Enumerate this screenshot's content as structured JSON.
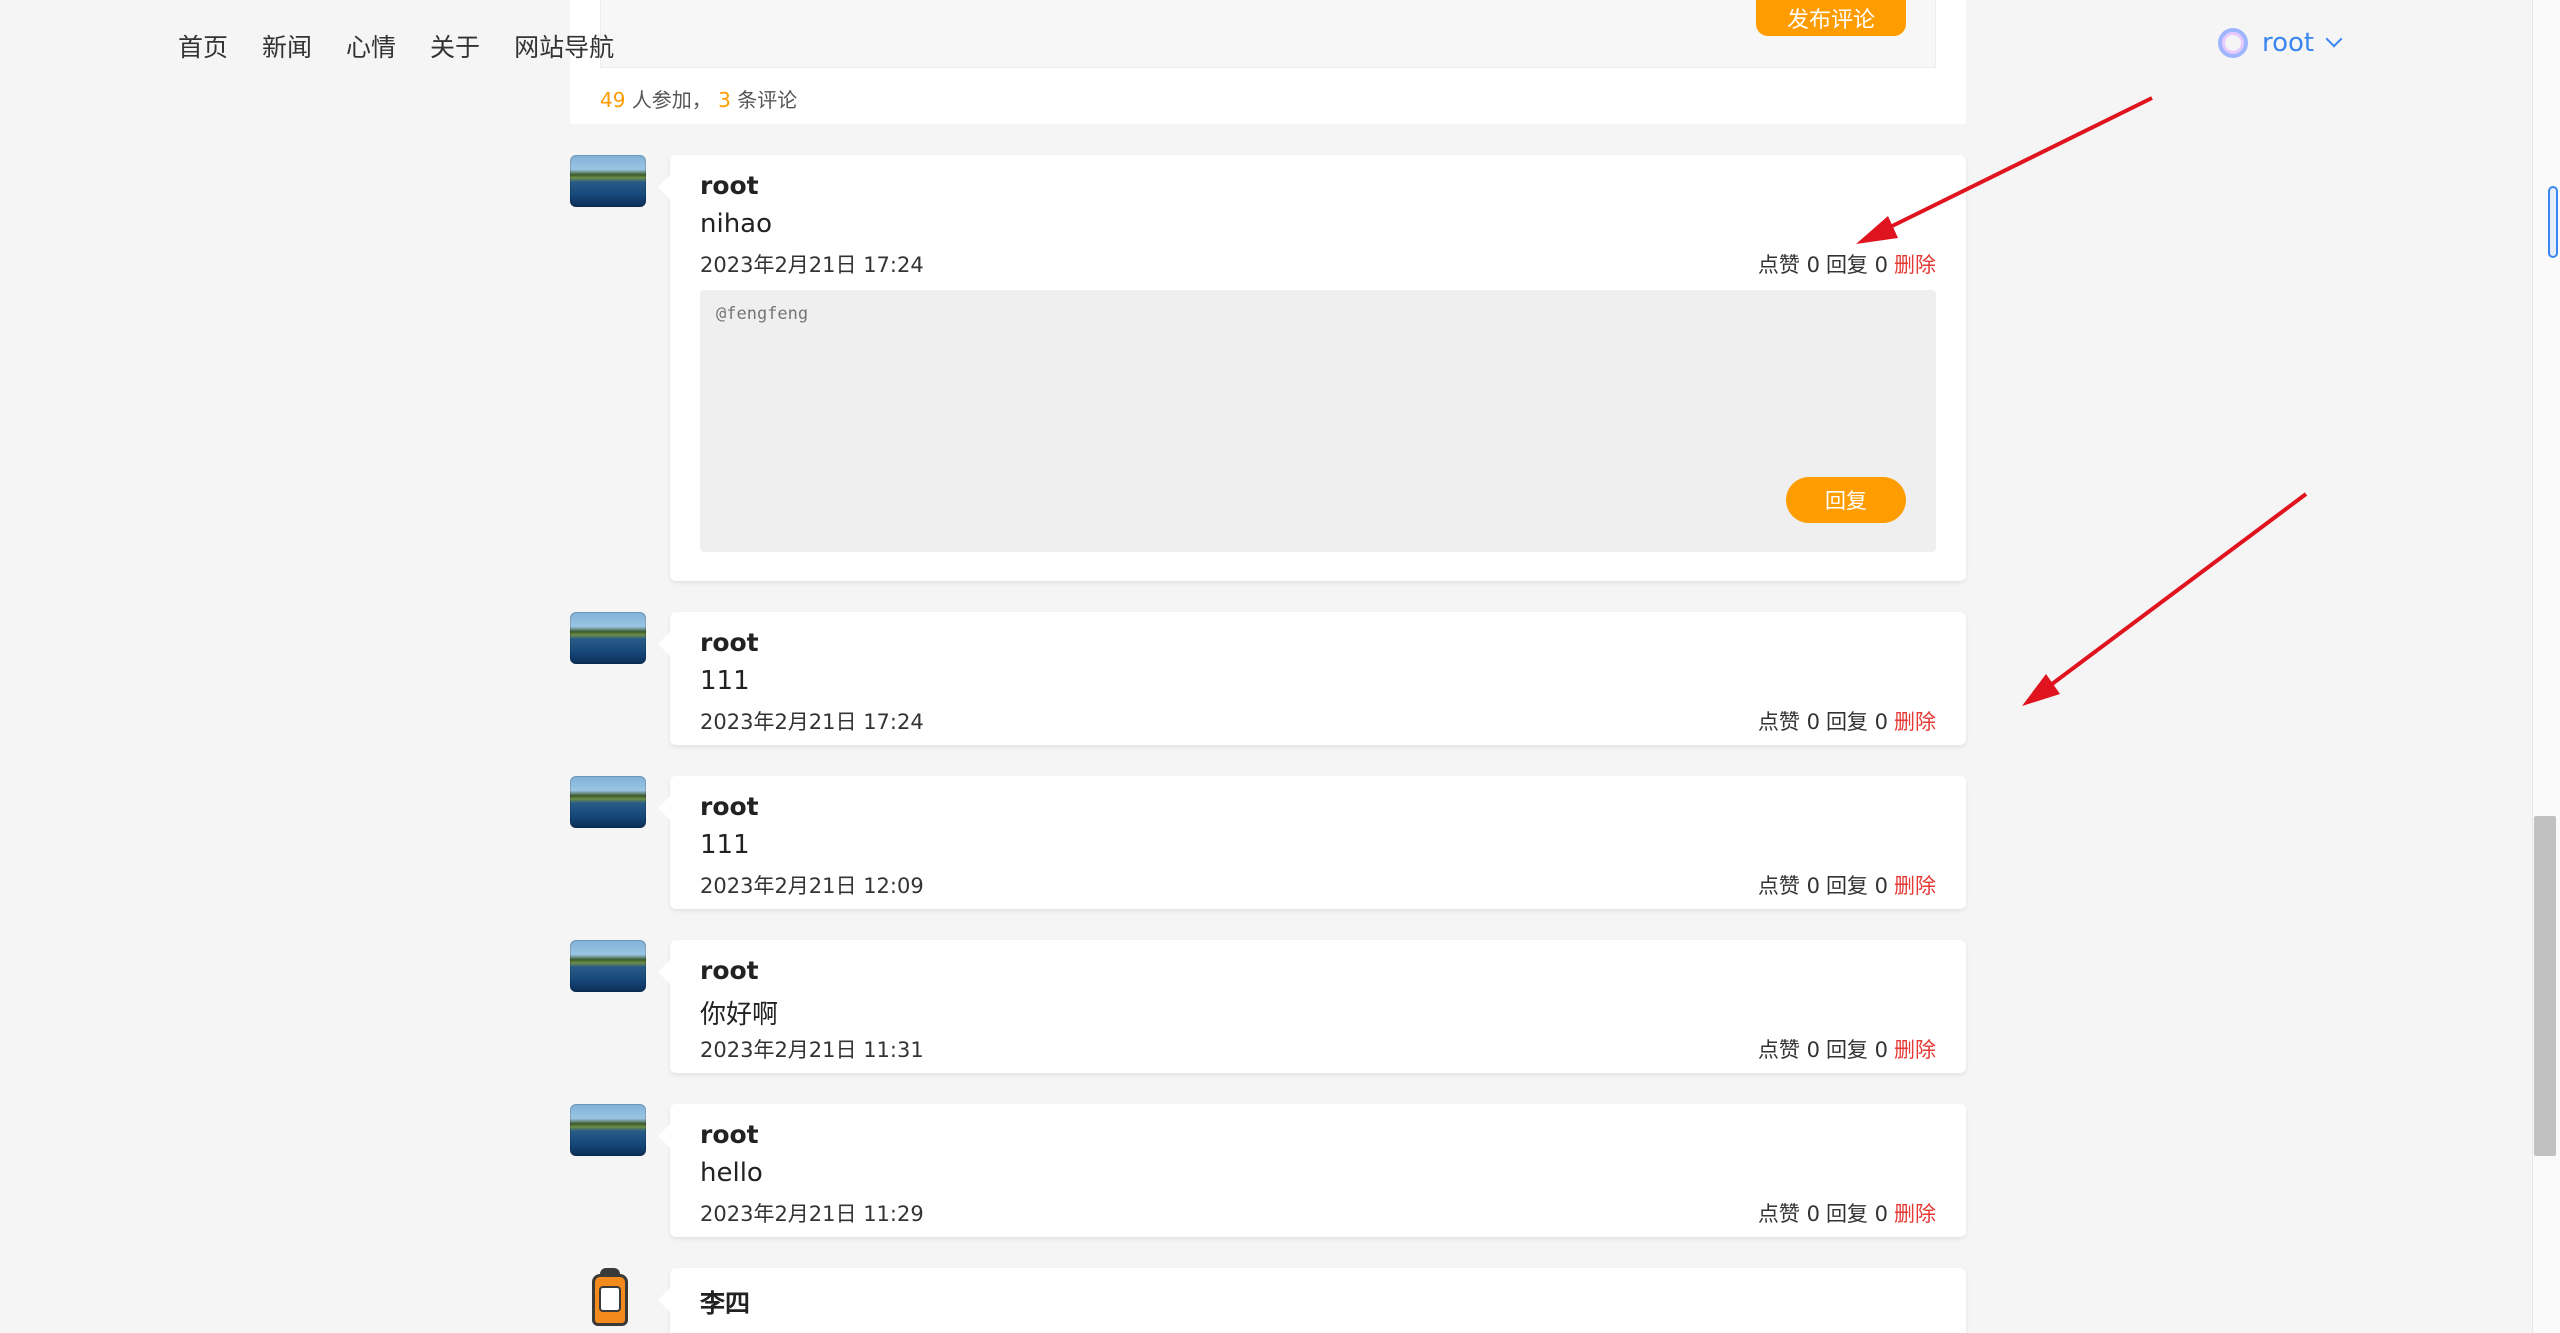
{
  "nav": {
    "items": [
      "首页",
      "新闻",
      "心情",
      "关于",
      "网站导航"
    ]
  },
  "user": {
    "name": "root"
  },
  "comment_box": {
    "publish_label": "发布评论",
    "participants": "49",
    "participants_suffix": "人参加，",
    "comment_count": "3",
    "comment_suffix": "条评论"
  },
  "comments": [
    {
      "name": "root",
      "content": "nihao",
      "time": "2023年2月21日 17:24",
      "like_label": "点赞",
      "likes": "0",
      "reply_label": "回复",
      "replies": "0",
      "delete_label": "删除"
    },
    {
      "name": "root",
      "content": "111",
      "time": "2023年2月21日 17:24",
      "like_label": "点赞",
      "likes": "0",
      "reply_label": "回复",
      "replies": "0",
      "delete_label": "删除"
    },
    {
      "name": "root",
      "content": "111",
      "time": "2023年2月21日 12:09",
      "like_label": "点赞",
      "likes": "0",
      "reply_label": "回复",
      "replies": "0",
      "delete_label": "删除"
    },
    {
      "name": "root",
      "content": "你好啊",
      "time": "2023年2月21日 11:31",
      "like_label": "点赞",
      "likes": "0",
      "reply_label": "回复",
      "replies": "0",
      "delete_label": "删除"
    },
    {
      "name": "root",
      "content": "hello",
      "time": "2023年2月21日 11:29",
      "like_label": "点赞",
      "likes": "0",
      "reply_label": "回复",
      "replies": "0",
      "delete_label": "删除"
    },
    {
      "name": "李四",
      "content": ""
    }
  ],
  "reply_form": {
    "placeholder": "@fengfeng",
    "submit_label": "回复"
  },
  "colors": {
    "accent": "#ff9c00",
    "user_link": "#3a86f0",
    "delete": "#e53935",
    "annotation_arrow": "#e0141e"
  }
}
